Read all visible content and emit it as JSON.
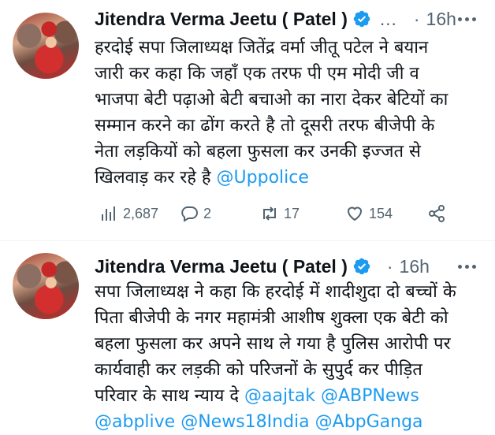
{
  "tweets": [
    {
      "author": "Jitendra Verma Jeetu ( Patel )",
      "truncation": "…",
      "separator": "·",
      "time": "16h",
      "text_lines": [
        "हरदोई सपा जिलाध्यक्ष जितेंद्र वर्मा जीतू पटेल ने बयान",
        "जारी कर कहा कि जहाँ एक तरफ पी एम मोदी जी व",
        "भाजपा बेटी पढ़ाओ बेटी बचाओ का नारा देकर बेटियों का",
        "सम्मान करने का ढोंग करते है तो दूसरी तरफ बीजेपी के",
        "नेता लड़कियों को बहला फुसला कर उनकी इज्जत से",
        "खिलवाड़ कर रहे है"
      ],
      "mention_inline": "@Uppolice",
      "stats": {
        "views": "2,687",
        "replies": "2",
        "retweets": "17",
        "likes": "154"
      }
    },
    {
      "author": "Jitendra Verma Jeetu ( Patel )",
      "separator": "·",
      "time": "16h",
      "text_lines": [
        "सपा जिलाध्यक्ष ने कहा कि हरदोई में शादीशुदा दो बच्चों के",
        "पिता बीजेपी के नगर महामंत्री आशीष शुक्ला एक बेटी को",
        "बहला फुसला कर अपने साथ ले गया है पुलिस आरोपी पर",
        "कार्यवाही कर लड़की को परिजनों के सुपुर्द कर पीड़ित",
        "परिवार के साथ न्याय दे"
      ],
      "mentions_line5": [
        "@aajtak",
        "@ABPNews"
      ],
      "mentions_line6": [
        "@abplive",
        "@News18India",
        "@AbpGanga"
      ]
    }
  ],
  "colors": {
    "text": "#0f1419",
    "secondary": "#536471",
    "link": "#1d9bf0",
    "verified": "#1d9bf0"
  },
  "icons": {
    "verified": "verified-badge-icon",
    "views": "views-bar-chart-icon",
    "reply": "reply-bubble-icon",
    "retweet": "retweet-icon",
    "like": "heart-icon",
    "share": "share-nodes-icon",
    "more": "more-dots-icon"
  }
}
